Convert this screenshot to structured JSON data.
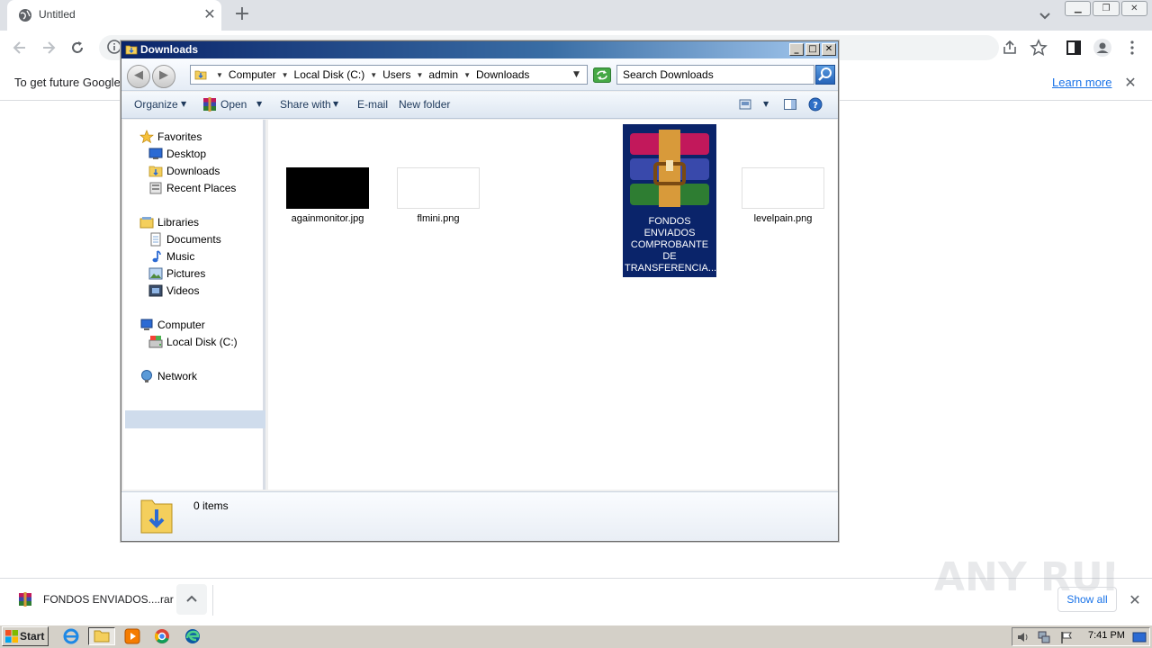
{
  "browser": {
    "tab_title": "Untitled",
    "tab_close": "✕",
    "new_tab": "+",
    "infobar_text": "To get future Google",
    "infobar_link": "Learn more",
    "infobar_close": "✕"
  },
  "downloads_shelf": {
    "file_name": "FONDOS ENVIADOS....rar",
    "show_all": "Show all",
    "close": "✕"
  },
  "explorer": {
    "title": "Downloads",
    "breadcrumbs": [
      "Computer",
      "Local Disk (C:)",
      "Users",
      "admin",
      "Downloads"
    ],
    "search_placeholder": "Search Downloads",
    "commands": {
      "organize": "Organize",
      "open": "Open",
      "share_with": "Share with",
      "email": "E-mail",
      "new_folder": "New folder"
    },
    "nav": {
      "favorites": "Favorites",
      "desktop": "Desktop",
      "downloads": "Downloads",
      "recent_places": "Recent Places",
      "libraries": "Libraries",
      "documents": "Documents",
      "music": "Music",
      "pictures": "Pictures",
      "videos": "Videos",
      "computer": "Computer",
      "local_disk": "Local Disk (C:)",
      "network": "Network"
    },
    "files": [
      {
        "name": "againmonitor.jpg",
        "thumb": "black"
      },
      {
        "name": "flmini.png",
        "thumb": "white"
      },
      {
        "name": "FONDOS ENVIADOS COMPROBANTE DE TRANSFERENCIA...",
        "thumb": "winrar-icon"
      },
      {
        "name": "levelpain.png",
        "thumb": "white"
      }
    ],
    "status": "0 items"
  },
  "taskbar": {
    "start": "Start",
    "clock": "7:41 PM"
  },
  "watermark": "ANY RUN",
  "colors": {
    "selection": "#0a246a",
    "link": "#1a73e8",
    "titlebar": "#0a246a"
  }
}
